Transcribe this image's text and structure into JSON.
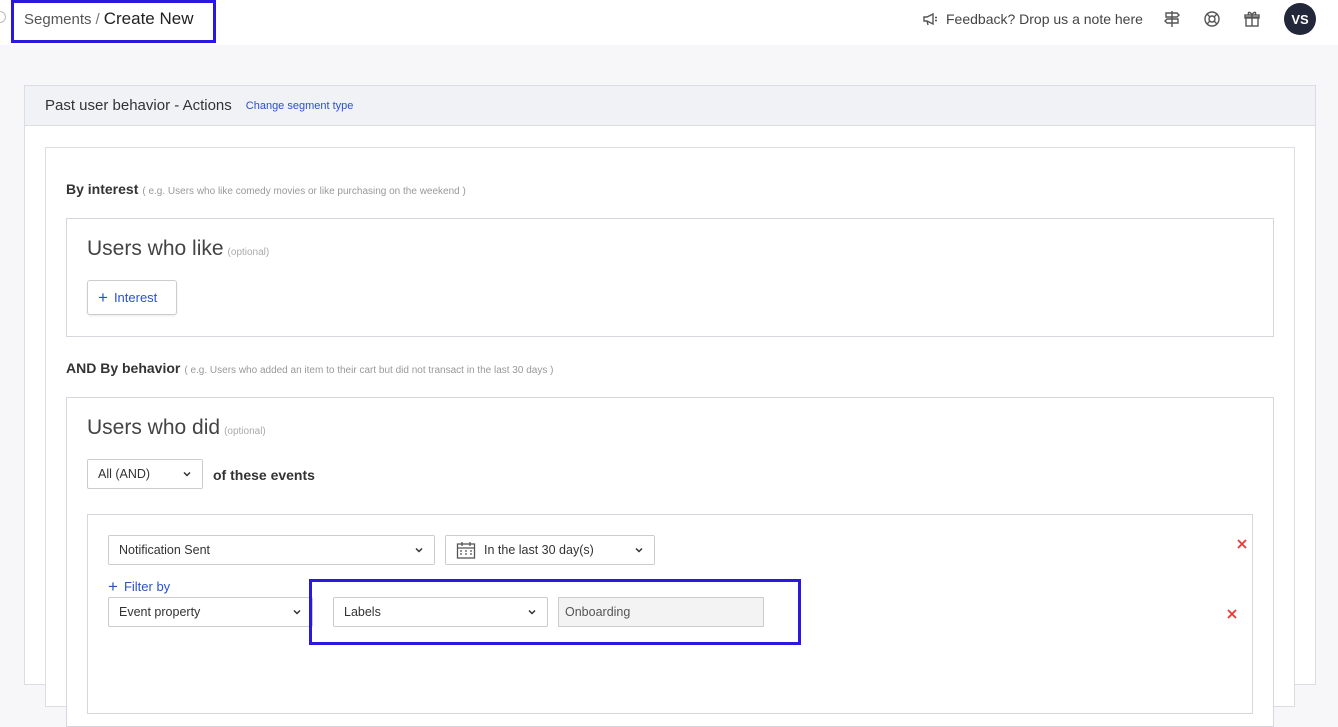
{
  "breadcrumb": {
    "parent": "Segments",
    "separator": "/",
    "current": "Create New"
  },
  "topbar": {
    "feedback_label": "Feedback? Drop us a note here",
    "avatar_initials": "VS"
  },
  "card": {
    "title": "Past user behavior - Actions",
    "change_link": "Change segment type"
  },
  "interest_section": {
    "label": "By interest",
    "hint": "( e.g. Users who like comedy movies or like purchasing on the weekend )",
    "box_title": "Users who like",
    "optional": "(optional)",
    "add_button": "Interest"
  },
  "behavior_section": {
    "label": "AND By behavior",
    "hint": "( e.g. Users who added an item to their cart but did not transact in the last 30 days )",
    "box_title": "Users who did",
    "optional": "(optional)",
    "match_select": "All (AND)",
    "match_suffix": "of these events",
    "event": {
      "name_select": "Notification Sent",
      "time_select": "In the last 30 day(s)",
      "filter_by_label": "Filter by",
      "filter_type_select": "Event property",
      "property_select": "Labels",
      "property_value": "Onboarding"
    }
  },
  "colors": {
    "accent": "#2a52c9",
    "highlight": "#2b18e0",
    "danger": "#e53935",
    "avatar_bg": "#22273a"
  }
}
